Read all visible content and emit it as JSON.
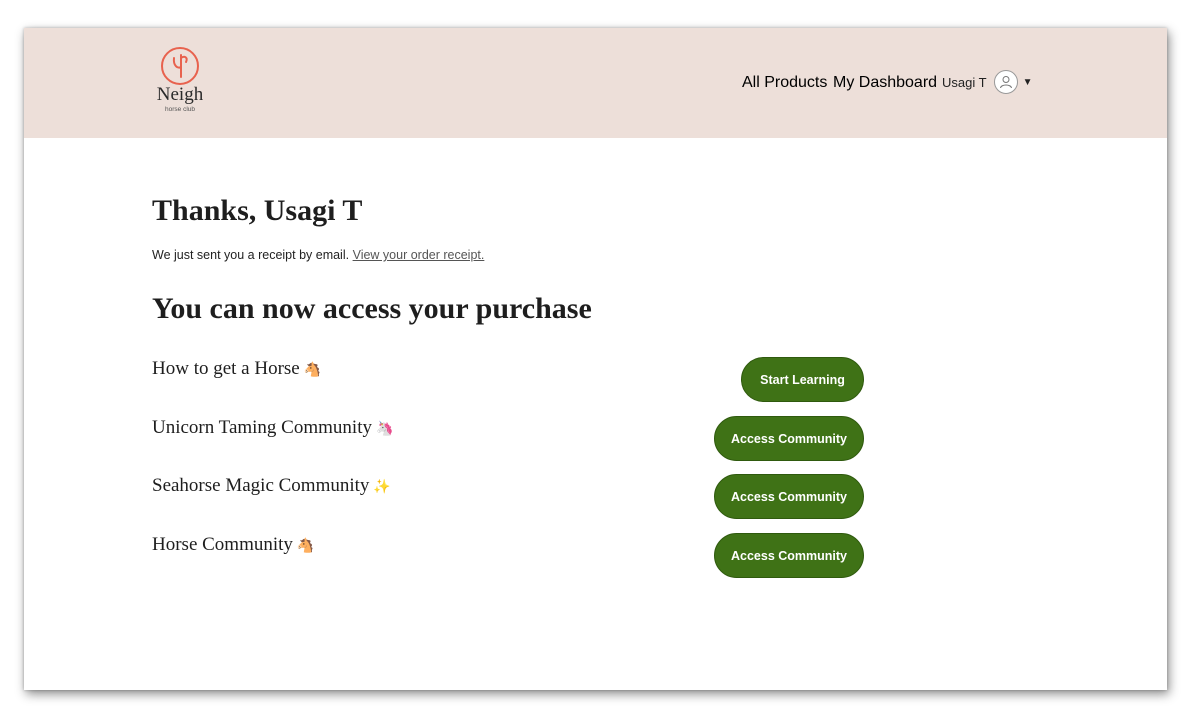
{
  "brand": {
    "name": "Neigh",
    "tagline": "horse club",
    "accent_color": "#e8624e"
  },
  "nav": {
    "all_products": "All Products",
    "my_dashboard": "My Dashboard",
    "user_name": "Usagi T",
    "avatar_icon": "user-avatar-icon",
    "caret_icon": "caret-down-icon"
  },
  "confirmation": {
    "title": "Thanks, Usagi T",
    "receipt_text": "We just sent you a receipt by email.",
    "receipt_link": "View your order receipt.",
    "access_title": "You can now access your purchase"
  },
  "products": [
    {
      "name": "How to get a Horse",
      "emoji": "🐴",
      "button": "Start Learning"
    },
    {
      "name": "Unicorn Taming Community",
      "emoji": "🦄",
      "button": "Access Community"
    },
    {
      "name": "Seahorse Magic Community",
      "emoji": "✨",
      "button": "Access Community"
    },
    {
      "name": "Horse Community",
      "emoji": "🐴",
      "button": "Access Community"
    }
  ],
  "colors": {
    "header_bg": "#eddfd9",
    "button_bg": "#3f7216"
  }
}
